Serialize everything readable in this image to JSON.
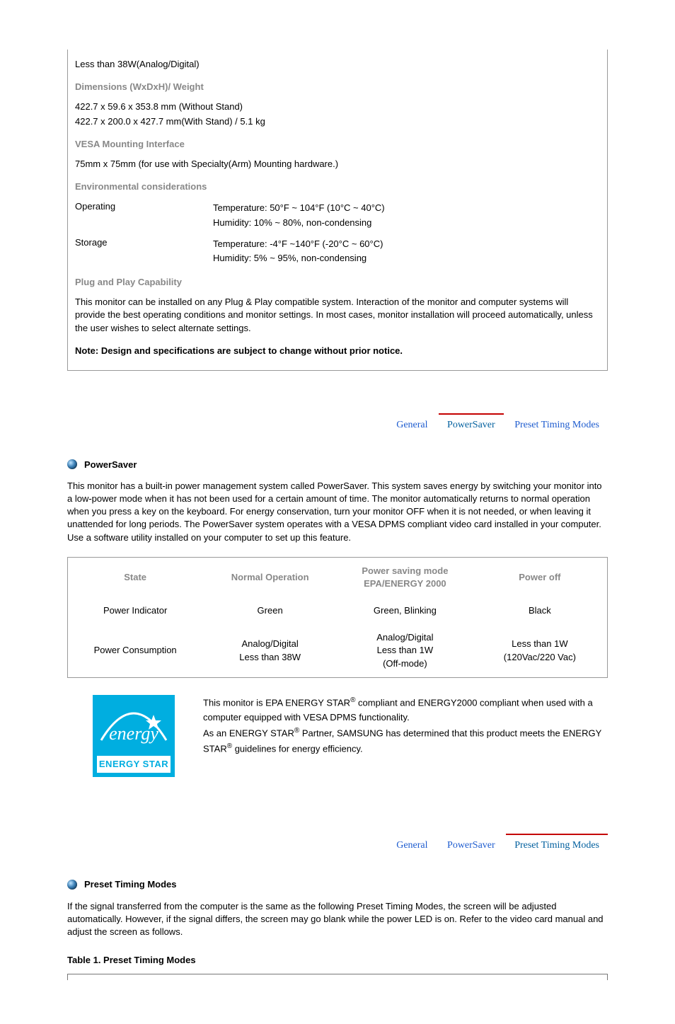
{
  "spec": {
    "power_value": "Less than 38W(Analog/Digital)",
    "dim_head": "Dimensions (WxDxH)/ Weight",
    "dim_l1": "422.7 x 59.6 x 353.8 mm (Without Stand)",
    "dim_l2": "422.7 x 200.0 x 427.7 mm(With Stand) / 5.1 kg",
    "vesa_head": "VESA Mounting Interface",
    "vesa_val": "75mm x 75mm (for use with Specialty(Arm) Mounting hardware.)",
    "env_head": "Environmental considerations",
    "env_op_label": "Operating",
    "env_op_l1": "Temperature: 50°F ~ 104°F (10°C ~ 40°C)",
    "env_op_l2": "Humidity: 10% ~ 80%, non-condensing",
    "env_st_label": "Storage",
    "env_st_l1": "Temperature: -4°F ~140°F (-20°C ~ 60°C)",
    "env_st_l2": "Humidity: 5% ~ 95%, non-condensing",
    "pnp_head": "Plug and Play Capability",
    "pnp_val": "This monitor can be installed on any Plug & Play compatible system. Interaction of the monitor and computer systems will provide the best operating conditions and monitor settings. In most cases, monitor installation will proceed automatically, unless the user wishes to select alternate settings.",
    "note": "Note: Design and specifications are subject to change without prior notice."
  },
  "tabs1": {
    "general": "General",
    "powersaver": "PowerSaver",
    "preset": "Preset Timing Modes"
  },
  "powersaver": {
    "title": "PowerSaver",
    "para": "This monitor has a built-in power management system called PowerSaver. This system saves energy by switching your monitor into a low-power mode when it has not been used for a certain amount of time. The monitor automatically returns to normal operation when you press a key on the keyboard. For energy conservation, turn your monitor OFF when it is not needed, or when leaving it unattended for long periods. The PowerSaver system operates with a VESA DPMS compliant video card installed in your computer. Use a software utility installed on your computer to set up this feature.",
    "table": {
      "h_state": "State",
      "h_normal": "Normal Operation",
      "h_saving_l1": "Power saving mode",
      "h_saving_l2": "EPA/ENERGY 2000",
      "h_off": "Power off",
      "r1c1": "Power Indicator",
      "r1c2": "Green",
      "r1c3": "Green, Blinking",
      "r1c4": "Black",
      "r2c1": "Power Consumption",
      "r2c2_l1": "Analog/Digital",
      "r2c2_l2": "Less than 38W",
      "r2c3_l1": "Analog/Digital",
      "r2c3_l2": "Less than 1W",
      "r2c3_l3": "(Off-mode)",
      "r2c4_l1": "Less than 1W",
      "r2c4_l2": "(120Vac/220 Vac)"
    },
    "logo_script": "energy",
    "logo_band": "ENERGY STAR",
    "es_p1a": "This monitor is EPA ENERGY STAR",
    "es_p1b": " compliant and ENERGY2000 compliant when used with a computer equipped with VESA DPMS functionality.",
    "es_p2a": "As an ENERGY STAR",
    "es_p2b": " Partner, SAMSUNG has determined that this product meets the ENERGY STAR",
    "es_p2c": " guidelines for energy efficiency.",
    "reg": "®"
  },
  "tabs2": {
    "general": "General",
    "powersaver": "PowerSaver",
    "preset": "Preset Timing Modes"
  },
  "preset": {
    "title": "Preset Timing Modes",
    "para": "If the signal transferred from the computer is the same as the following Preset Timing Modes, the screen will be adjusted automatically. However, if the signal differs, the screen may go blank while the power LED is on. Refer to the video card manual and adjust the screen as follows.",
    "caption": "Table 1. Preset Timing Modes"
  }
}
